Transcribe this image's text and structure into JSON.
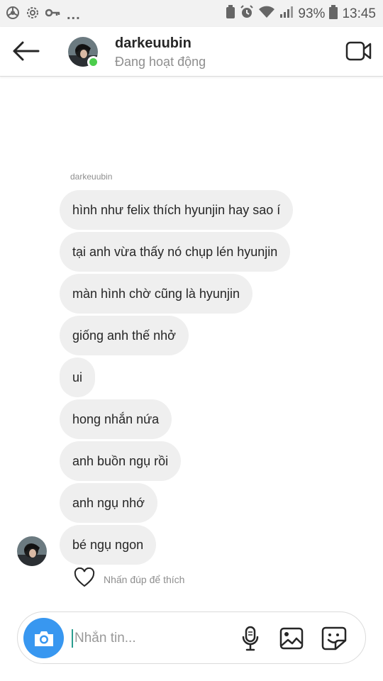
{
  "status_bar": {
    "icons_left": [
      "chrome-icon",
      "settings-icon",
      "key-icon"
    ],
    "overflow": "...",
    "battery_percent": "93%",
    "time": "13:45"
  },
  "header": {
    "username": "darkeuubin",
    "activity_status": "Đang hoạt động"
  },
  "conversation": {
    "sender_label": "darkeuubin",
    "messages": [
      "hình như felix thích hyunjin hay sao í",
      "tại anh vừa thấy nó chụp lén hyunjin",
      "màn hình chờ cũng là hyunjin",
      "giống anh thế nhở",
      "ui",
      "hong nhắn nứa",
      "anh buồn ngụ rồi",
      "anh ngụ nhớ",
      "bé ngụ ngon"
    ],
    "like_hint": "Nhấn đúp để thích"
  },
  "composer": {
    "placeholder": "Nhắn tin..."
  },
  "colors": {
    "accent": "#3897f0",
    "online": "#4ccd4c",
    "bubble": "#efefef"
  }
}
